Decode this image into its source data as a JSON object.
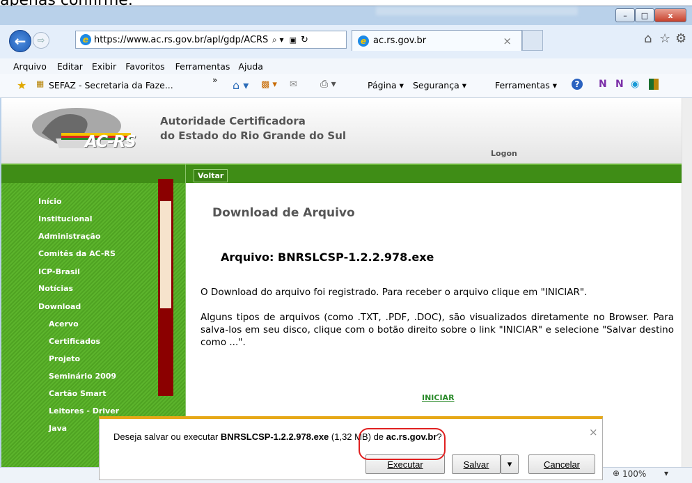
{
  "caption": "apenas confirme.",
  "window": {
    "minimize": "–",
    "maximize": "□",
    "close": "x"
  },
  "nav": {
    "url": "https://www.ac.rs.gov.br/apl/gdp/ACRS/​",
    "search_glyph": "⌕ ▾",
    "lock_glyph": "🔒",
    "refresh_glyph": "↻",
    "tab_title": "ac.rs.gov.br",
    "tab_close": "×",
    "home": "⌂",
    "star": "☆",
    "gear": "⚙"
  },
  "menu": [
    "Arquivo",
    "Editar",
    "Exibir",
    "Favoritos",
    "Ferramentas",
    "Ajuda"
  ],
  "favorites": {
    "item": "SEFAZ - Secretaria da Faze...",
    "chevron": "»",
    "pagina": "Página ▾",
    "seguranca": "Segurança ▾",
    "ferramentas": "Ferramentas ▾"
  },
  "site": {
    "logo_text": "AC-RS",
    "header_line1": "Autoridade Certificadora",
    "header_line2": "do Estado do Rio Grande do Sul",
    "logon": "Logon",
    "voltar": "Voltar",
    "menu": [
      "Início",
      "Institucional",
      "Administração",
      "Comitês da AC-RS",
      "ICP-Brasil",
      "Notícias",
      "Download"
    ],
    "submenu": [
      "Acervo",
      "Certificados",
      "Projeto",
      "Seminário 2009",
      "Cartão Smart",
      "Leitores - Driver",
      "Java"
    ],
    "page_title": "Download de Arquivo",
    "file_heading": "Arquivo: BNRSLCSP-1.2.2.978.exe",
    "para1": "O Download do arquivo foi registrado. Para receber o arquivo clique em \"INICIAR\".",
    "para2": "Alguns tipos de arquivos (como .TXT, .PDF, .DOC), são visualizados diretamente no Browser. Para salva-los em seu disco, clique com o botão direito sobre o link \"INICIAR\" e selecione \"Salvar destino como ...\".",
    "iniciar": "INICIAR"
  },
  "status": {
    "zoom": "100%",
    "zoom_arrow": "▾"
  },
  "dialog": {
    "prefix": "Deseja salvar ou executar ",
    "filename": "BNRSLCSP-1.2.2.978.exe",
    "size": " (1,32 MB) de ",
    "host": "ac.rs.gov.br",
    "suffix": "?",
    "close": "×",
    "run": "Executar",
    "save": "Salvar",
    "save_arrow": "▾",
    "cancel": "Cancelar"
  }
}
